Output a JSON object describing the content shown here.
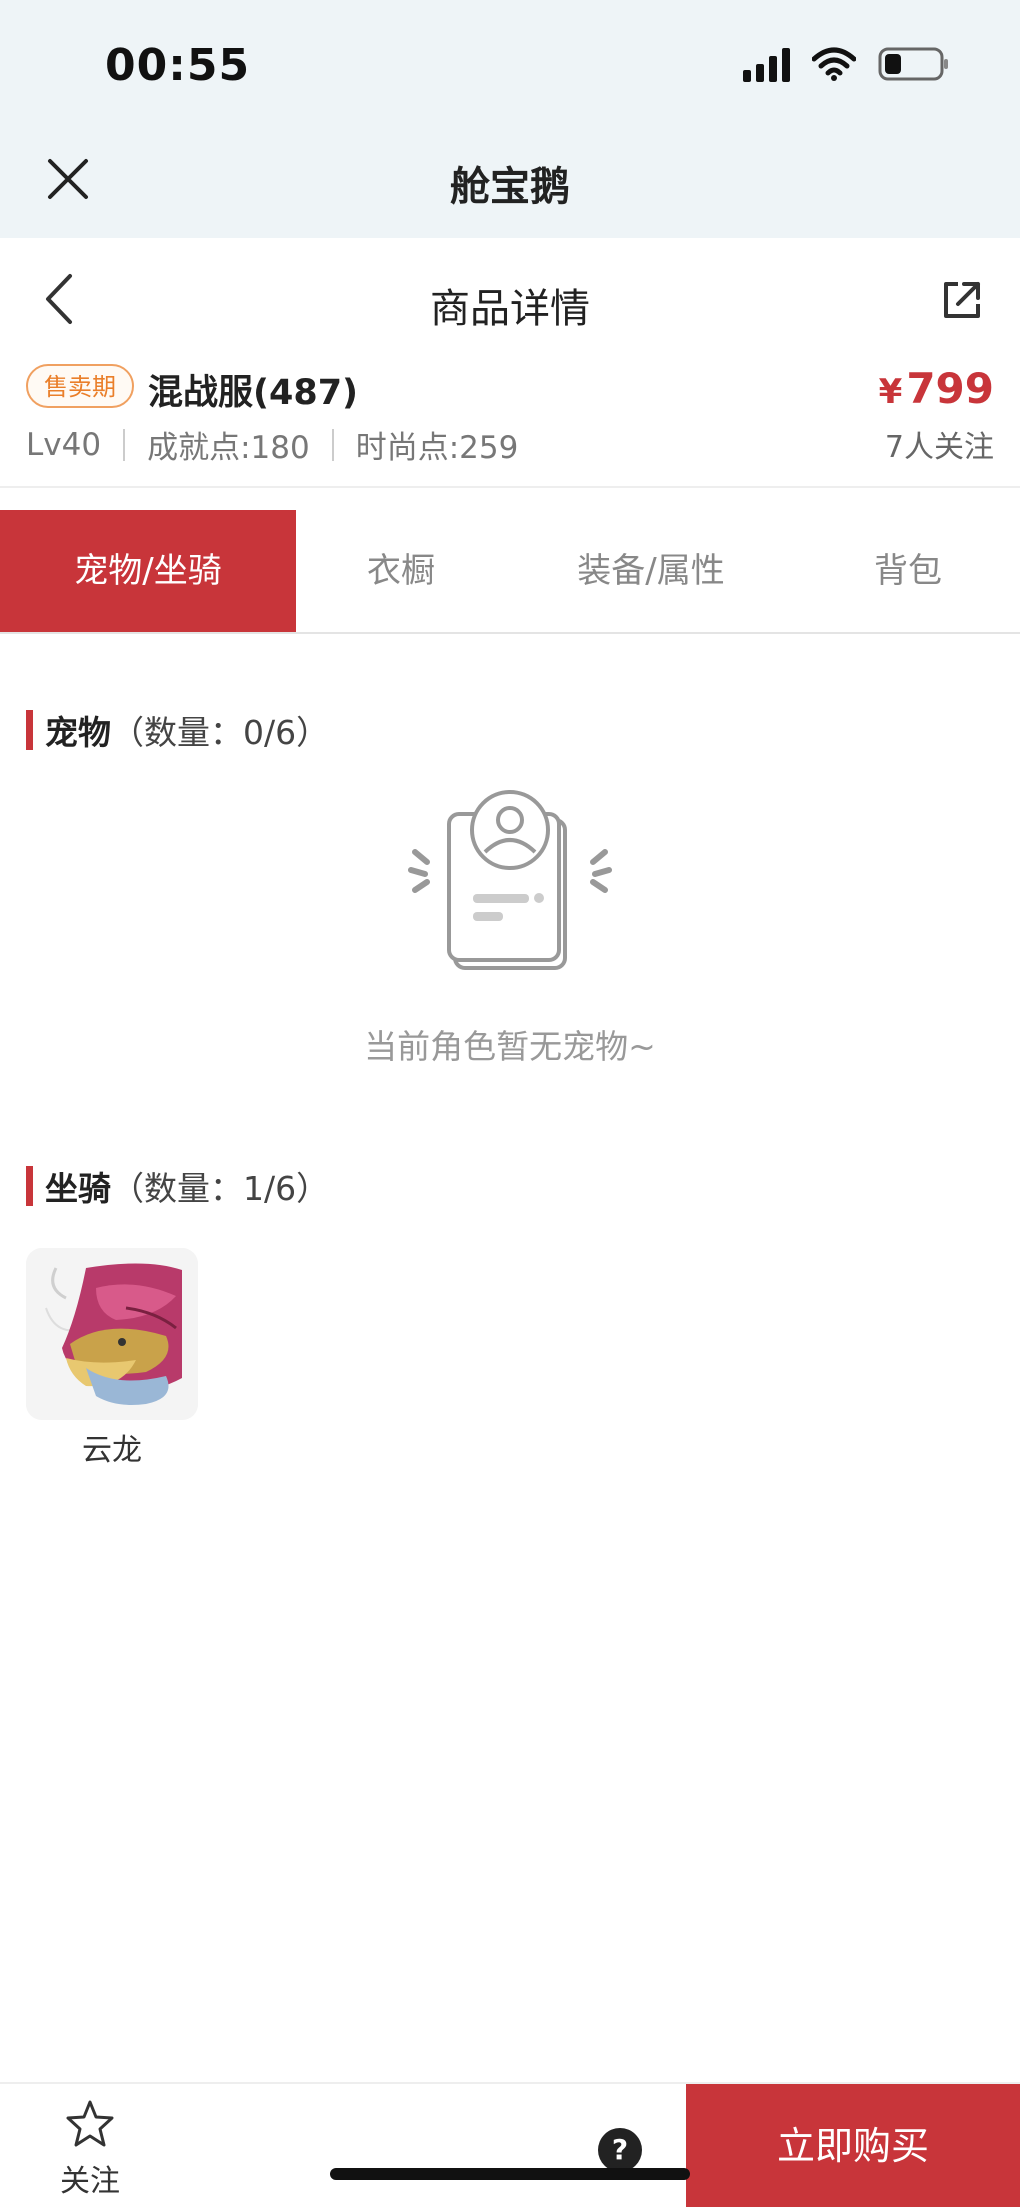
{
  "status_bar": {
    "time": "00:55"
  },
  "app_header": {
    "title": "舱宝鹅"
  },
  "nav": {
    "title": "商品详情"
  },
  "product": {
    "badge": "售卖期",
    "server": "混战服(487)",
    "level": "Lv40",
    "achievement": "成就点:180",
    "fashion": "时尚点:259",
    "price_symbol": "¥",
    "price": "799",
    "followers": "7人关注"
  },
  "tabs": [
    {
      "label": "宠物/坐骑",
      "active": true
    },
    {
      "label": "衣橱",
      "active": false
    },
    {
      "label": "装备/属性",
      "active": false
    },
    {
      "label": "背包",
      "active": false
    }
  ],
  "pets": {
    "title": "宠物",
    "count": "（数量：0/6）",
    "empty_text": "当前角色暂无宠物~"
  },
  "mounts": {
    "title": "坐骑",
    "count": "（数量：1/6）",
    "items": [
      {
        "name": "云龙"
      }
    ]
  },
  "bottom_bar": {
    "follow_label": "关注",
    "help_label": "?",
    "buy_label": "立即购买"
  },
  "colors": {
    "accent": "#c8353a",
    "badge": "#ea7f2a",
    "header_bg": "#eef4f7"
  }
}
